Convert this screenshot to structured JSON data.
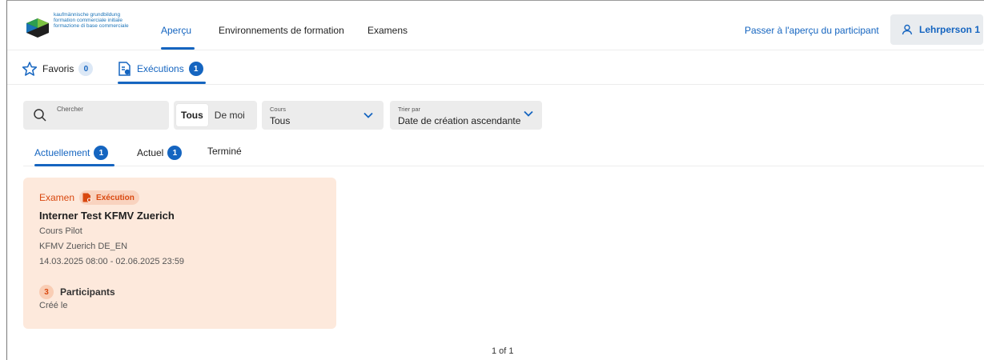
{
  "brand": {
    "logo_lines": [
      "kaufmännische grundbildung",
      "formation commerciale initiale",
      "formazione di base commerciale"
    ],
    "colors": {
      "accent": "#1565c0",
      "exam": "#d9480f",
      "card_bg": "#fde9dc"
    }
  },
  "nav": {
    "items": [
      {
        "label": "Aperçu",
        "active": true
      },
      {
        "label": "Environnements de formation",
        "active": false
      },
      {
        "label": "Examens",
        "active": false
      }
    ],
    "switch_label": "Passer à l'aperçu du participant",
    "user_label": "Lehrperson 1",
    "user_icon": "user-icon"
  },
  "subtabs": {
    "favorites": {
      "label": "Favoris",
      "count": "0",
      "icon": "star-icon"
    },
    "executions": {
      "label": "Exécutions",
      "count": "1",
      "icon": "execution-icon"
    }
  },
  "filters": {
    "search_label": "Chercher",
    "toggle": {
      "on": "Tous",
      "off": "De moi"
    },
    "course": {
      "caption": "Cours",
      "value": "Tous"
    },
    "sort": {
      "caption": "Trier par",
      "value": "Date de création ascendante"
    }
  },
  "status_tabs": [
    {
      "label": "Actuellement",
      "count": "1",
      "active": true
    },
    {
      "label": "Actuel",
      "count": "1",
      "active": false
    },
    {
      "label": "Terminé",
      "count": "",
      "active": false
    }
  ],
  "card": {
    "type_label": "Examen",
    "status_label": "Exécution",
    "title": "Interner Test KFMV Zuerich",
    "course": "Cours Pilot",
    "group": "KFMV Zuerich DE_EN",
    "period": "14.03.2025 08:00 - 02.06.2025 23:59",
    "participants_count": "3",
    "participants_label": "Participants",
    "created_label": "Créé le"
  },
  "pagination": {
    "label": "1 of 1"
  }
}
